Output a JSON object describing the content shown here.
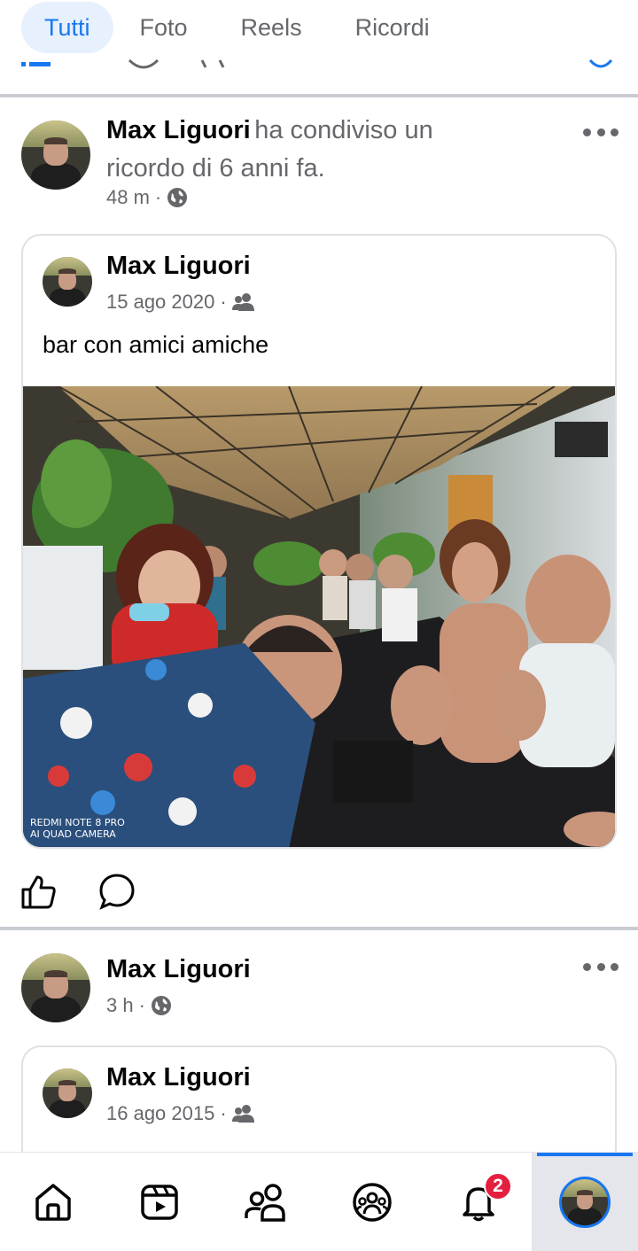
{
  "tabs": [
    {
      "label": "Tutti",
      "active": true
    },
    {
      "label": "Foto",
      "active": false
    },
    {
      "label": "Reels",
      "active": false
    },
    {
      "label": "Ricordi",
      "active": false
    }
  ],
  "post1": {
    "author": "Max Liguori",
    "action_text": "ha condiviso un ricordo di 6 anni fa.",
    "time": "48 m",
    "audience_icon": "globe-icon",
    "shared_post": {
      "author": "Max Liguori",
      "date": "15 ago 2020",
      "audience_icon": "friends-icon",
      "caption": "bar con amici amiche",
      "photo_watermark_line1": "REDMI NOTE 8 PRO",
      "photo_watermark_line2": "AI QUAD CAMERA"
    }
  },
  "post2": {
    "author": "Max Liguori",
    "time": "3 h",
    "audience_icon": "globe-icon",
    "shared_post": {
      "author": "Max Liguori",
      "date": "16 ago 2015",
      "audience_icon": "friends-icon"
    }
  },
  "bottom_nav": {
    "items": [
      "home-icon",
      "video-icon",
      "friends-icon",
      "groups-icon",
      "notifications-icon",
      "profile-avatar"
    ],
    "notifications_badge": "2",
    "active": "profile-avatar"
  },
  "colors": {
    "accent": "#1877f2",
    "secondary_text": "#65676b",
    "badge": "#e41e3f"
  }
}
